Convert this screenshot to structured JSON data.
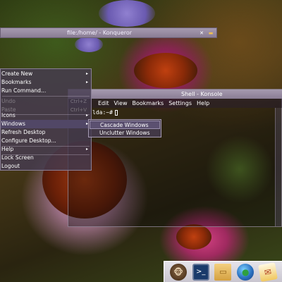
{
  "konqueror": {
    "title": "file:/home/ - Konqueror",
    "icon": "folder-icon",
    "close_glyph": "✕"
  },
  "konsole": {
    "title": "Shell - Konsole",
    "menu": [
      "Edit",
      "View",
      "Bookmarks",
      "Settings",
      "Help"
    ],
    "prompt": "lda:~#"
  },
  "desktop_menu": {
    "items": [
      {
        "label": "Create New",
        "submenu": true
      },
      {
        "label": "Bookmarks",
        "submenu": true
      },
      {
        "label": "Run Command..."
      },
      {
        "label": "Undo",
        "disabled": true,
        "shortcut": "Ctrl+Z"
      },
      {
        "label": "Paste",
        "disabled": true,
        "shortcut": "Ctrl+V"
      },
      {
        "label": "Icons",
        "submenu": true
      },
      {
        "label": "Windows",
        "submenu": true,
        "active": true
      },
      {
        "label": "Refresh Desktop"
      },
      {
        "label": "Configure Desktop..."
      },
      {
        "label": "Help",
        "submenu": true
      },
      {
        "label": "Lock Screen"
      },
      {
        "label": "Logout"
      }
    ],
    "arrow_glyph": "▸"
  },
  "windows_submenu": {
    "items": [
      "Cascade Windows",
      "Unclutter Windows"
    ]
  },
  "panel": {
    "icons": [
      "monkey-icon",
      "terminal-icon",
      "folder-icon",
      "globe-icon",
      "mail-icon"
    ],
    "glyphs": [
      "🐵",
      ">_",
      "▭",
      "●",
      "✉"
    ]
  }
}
